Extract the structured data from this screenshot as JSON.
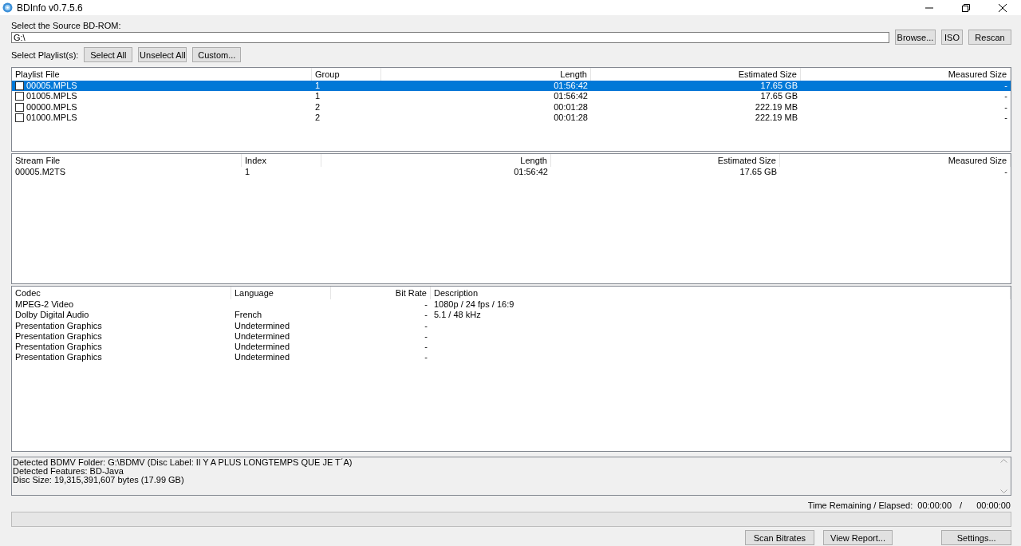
{
  "window": {
    "title": "BDInfo v0.7.5.6"
  },
  "source": {
    "label": "Select the Source BD-ROM:",
    "value": "G:\\",
    "buttons": [
      "Browse...",
      "ISO",
      "Rescan"
    ]
  },
  "playlist_select": {
    "label": "Select Playlist(s):",
    "buttons": [
      "Select All",
      "Unselect All",
      "Custom..."
    ]
  },
  "playlists": {
    "columns": [
      "Playlist File",
      "Group",
      "Length",
      "Estimated Size",
      "Measured Size"
    ],
    "rows": [
      {
        "file": "00005.MPLS",
        "group": "1",
        "length": "01:56:42",
        "estimated": "17.65 GB",
        "measured": "-",
        "checked": false,
        "selected": true
      },
      {
        "file": "01005.MPLS",
        "group": "1",
        "length": "01:56:42",
        "estimated": "17.65 GB",
        "measured": "-",
        "checked": false,
        "selected": false
      },
      {
        "file": "00000.MPLS",
        "group": "2",
        "length": "00:01:28",
        "estimated": "222.19 MB",
        "measured": "-",
        "checked": false,
        "selected": false
      },
      {
        "file": "01000.MPLS",
        "group": "2",
        "length": "00:01:28",
        "estimated": "222.19 MB",
        "measured": "-",
        "checked": false,
        "selected": false
      }
    ]
  },
  "streams": {
    "columns": [
      "Stream File",
      "Index",
      "Length",
      "Estimated Size",
      "Measured Size"
    ],
    "rows": [
      {
        "file": "00005.M2TS",
        "index": "1",
        "length": "01:56:42",
        "estimated": "17.65 GB",
        "measured": "-"
      }
    ]
  },
  "stream_info": {
    "columns": [
      "Codec",
      "Language",
      "Bit Rate",
      "Description"
    ],
    "rows": [
      {
        "codec": "MPEG-2 Video",
        "language": "",
        "bitrate": "-",
        "description": "1080p / 24 fps / 16:9"
      },
      {
        "codec": "Dolby Digital Audio",
        "language": "French",
        "bitrate": "-",
        "description": "5.1 / 48 kHz"
      },
      {
        "codec": "Presentation Graphics",
        "language": "Undetermined",
        "bitrate": "-",
        "description": ""
      },
      {
        "codec": "Presentation Graphics",
        "language": "Undetermined",
        "bitrate": "-",
        "description": ""
      },
      {
        "codec": "Presentation Graphics",
        "language": "Undetermined",
        "bitrate": "-",
        "description": ""
      },
      {
        "codec": "Presentation Graphics",
        "language": "Undetermined",
        "bitrate": "-",
        "description": ""
      }
    ]
  },
  "report": [
    "Detected BDMV Folder: G:\\BDMV (Disc Label: Il Y A PLUS LONGTEMPS QUE JE T´A)",
    "Detected Features: BD-Java",
    "Disc Size: 19,315,391,607 bytes (17.99 GB)"
  ],
  "time": {
    "label": "Time Remaining / Elapsed:",
    "remaining": "00:00:00",
    "separator": "/",
    "elapsed": "00:00:00"
  },
  "progress": {
    "level": 0
  },
  "bottom_buttons": [
    "Scan Bitrates",
    "View Report...",
    "Settings..."
  ]
}
